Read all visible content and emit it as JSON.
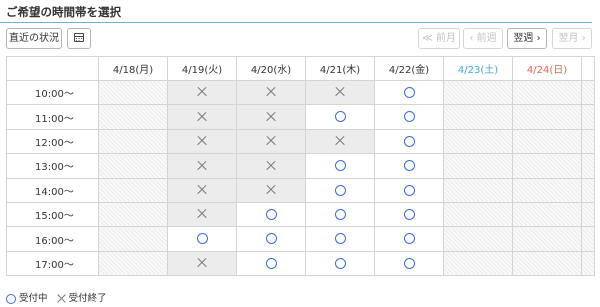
{
  "page_title": "ご希望の時間帯を選択",
  "toolbar": {
    "recent_status": "直近の状況",
    "prev_month": "≪ 前月",
    "prev_week": "‹ 前週",
    "next_week": "翌週 ›",
    "next_month": "翌月 ›"
  },
  "schedule": {
    "dates": [
      {
        "label": "4/18(月)",
        "kind": "weekday"
      },
      {
        "label": "4/19(火)",
        "kind": "weekday"
      },
      {
        "label": "4/20(水)",
        "kind": "weekday"
      },
      {
        "label": "4/21(木)",
        "kind": "weekday"
      },
      {
        "label": "4/22(金)",
        "kind": "weekday"
      },
      {
        "label": "4/23(土)",
        "kind": "saturday"
      },
      {
        "label": "4/24(日)",
        "kind": "sunday"
      }
    ],
    "rows": [
      {
        "time": "10:00〜",
        "slots": [
          "none",
          "closed",
          "closed",
          "closed",
          "open",
          "none",
          "none"
        ]
      },
      {
        "time": "11:00〜",
        "slots": [
          "none",
          "closed",
          "closed",
          "open",
          "open",
          "none",
          "none"
        ]
      },
      {
        "time": "12:00〜",
        "slots": [
          "none",
          "closed",
          "closed",
          "closed",
          "open",
          "none",
          "none"
        ]
      },
      {
        "time": "13:00〜",
        "slots": [
          "none",
          "closed",
          "closed",
          "open",
          "open",
          "none",
          "none"
        ]
      },
      {
        "time": "14:00〜",
        "slots": [
          "none",
          "closed",
          "closed",
          "open",
          "open",
          "none",
          "none"
        ]
      },
      {
        "time": "15:00〜",
        "slots": [
          "none",
          "closed",
          "open",
          "open",
          "open",
          "none",
          "none"
        ]
      },
      {
        "time": "16:00〜",
        "slots": [
          "none",
          "open",
          "open",
          "open",
          "open",
          "none",
          "none"
        ]
      },
      {
        "time": "17:00〜",
        "slots": [
          "none",
          "closed",
          "open",
          "open",
          "open",
          "none",
          "none"
        ]
      }
    ]
  },
  "legend": {
    "open_label": "受付中",
    "closed_label": "受付終了"
  },
  "icons": {
    "open": "circle-icon",
    "closed": "cross-icon",
    "calendar": "calendar-icon"
  },
  "colors": {
    "accent_rule": "#6cb4d8",
    "open_circle": "#3d6dd6",
    "saturday": "#4aa6d8",
    "sunday": "#e5675c",
    "closed_cell": "#ececec"
  }
}
